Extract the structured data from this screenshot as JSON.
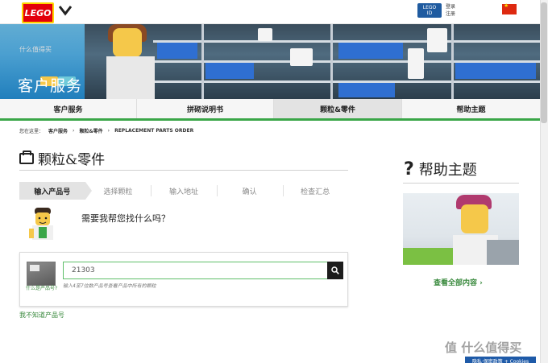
{
  "topbar": {
    "logo_text": "LEGO",
    "lego_id_line1": "LEGO",
    "lego_id_line2": "ID",
    "login_label": "登录",
    "register_label": "注册"
  },
  "hero": {
    "title": "客户服务",
    "watermark": "什么值得买"
  },
  "nav": {
    "items": [
      "客户服务",
      "拼砌说明书",
      "颗粒&零件",
      "帮助主题"
    ]
  },
  "breadcrumb": {
    "prefix": "您在这里：",
    "items": [
      "客户服务",
      "颗粒&零件",
      "REPLACEMENT PARTS ORDER"
    ]
  },
  "page": {
    "title": "颗粒&零件"
  },
  "steps": [
    "输入产品号",
    "选择颗粒",
    "输入地址",
    "确认",
    "检查汇总"
  ],
  "help_prompt": "需要我帮您找什么吗？",
  "search": {
    "value": "21303",
    "hint": "输入4至7位数产品号查看产品中所有的颗粒",
    "what_is_label": "什么是产品号?"
  },
  "dont_know_link": "我不知道产品号",
  "sidebar": {
    "title": "帮助主题",
    "see_all": "查看全部内容"
  },
  "footer": {
    "cookies_badge": "隐私·保密政策 + Cookies",
    "watermark": "值 什么值得买"
  },
  "colors": {
    "accent_green": "#3aa648",
    "lego_red": "#e3000b",
    "lego_yellow": "#ffd500",
    "id_blue": "#1f5ba0"
  }
}
